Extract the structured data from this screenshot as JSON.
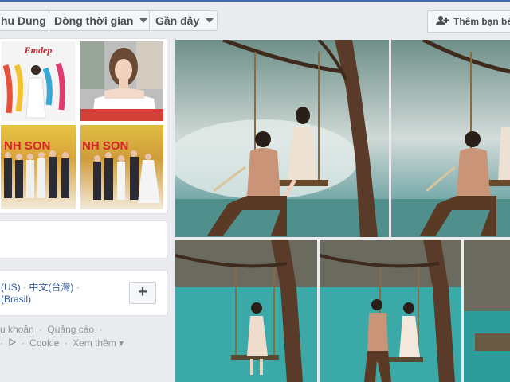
{
  "header": {
    "profile_name": "hu Dung",
    "timeline_label": "Dòng thời gian",
    "recent_label": "Gần đây",
    "add_friend_label": "Thêm bạn bè"
  },
  "photos": {
    "thumb1_brand": "Emdep",
    "thumb3_text": "NH SON",
    "thumb4_text": "NH SON"
  },
  "languages": {
    "row1_a": "(US)",
    "row1_sep": "·",
    "row1_b": "中文(台灣)",
    "row1_sep2": "·",
    "row2": "(Brasil)",
    "add_label": "+"
  },
  "footer": {
    "line1_a": "u khoản",
    "line1_sep": "·",
    "line1_b": "Quảng cáo",
    "line1_sep2": "·",
    "line2_sep": "·",
    "line2_a": "Cookie",
    "line2_sep2": "·",
    "line2_b": "Xem thêm",
    "line2_caret": "▾"
  },
  "colors": {
    "background": "#e9ebee",
    "link": "#365899",
    "water": "#4f9aa0",
    "trunk": "#5a3a28"
  },
  "icons": {
    "add_friend": "person-plus-icon",
    "dropdown": "caret-down-icon",
    "play": "adchoices-icon"
  }
}
